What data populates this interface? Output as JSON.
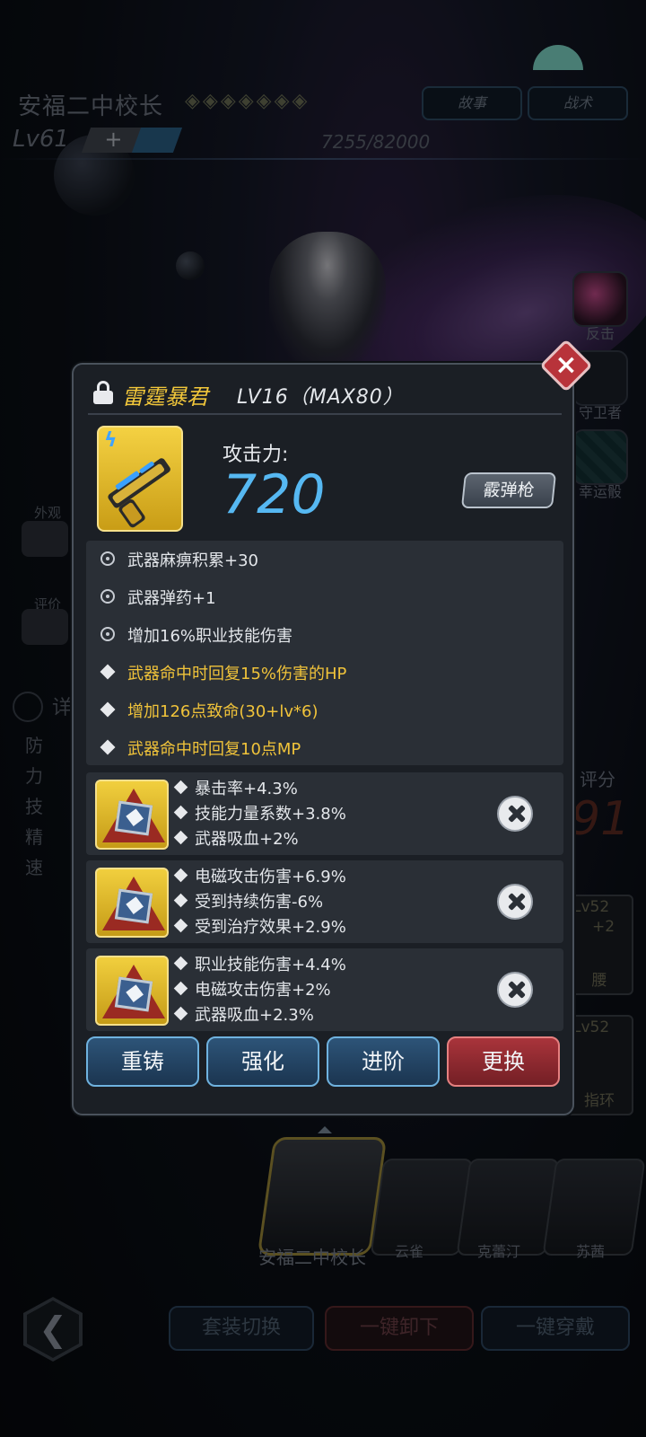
{
  "header": {
    "title": "安福二中校长",
    "stars": "◈◈◈◈◈◈◈",
    "level": "Lv61",
    "level_plus": "+",
    "exp": "7255/82000",
    "buttons": [
      "故事",
      "战术"
    ]
  },
  "right_skills": [
    {
      "label": "反击",
      "icon": "counter-icon"
    },
    {
      "label": "守卫者",
      "icon": "guardian-icon"
    },
    {
      "label": "幸运骰",
      "icon": "lucky-dice-icon"
    }
  ],
  "score": {
    "label": "评分",
    "value": "91"
  },
  "side_slots": [
    {
      "level": "Lv52",
      "extra": "+2",
      "label": "腰"
    },
    {
      "level": "Lv52",
      "label": "指环"
    }
  ],
  "left_panel": {
    "appearance": "外观",
    "review": "评价",
    "detail": "详",
    "stats": [
      "防",
      "力",
      "技",
      "精",
      "速"
    ]
  },
  "modal": {
    "weapon_name": "雷霆暴君",
    "weapon_level": "LV16（MAX80）",
    "attack_label": "攻击力:",
    "attack_value": "720",
    "weapon_type": "霰弹枪",
    "attributes": [
      {
        "text": "武器麻痹积累+30",
        "icon": "gear-icon",
        "highlight": false
      },
      {
        "text": "武器弹药+1",
        "icon": "gear-icon",
        "highlight": false
      },
      {
        "text": "增加16%职业技能伤害",
        "icon": "gear-icon",
        "highlight": false
      },
      {
        "text": "武器命中时回复15%伤害的HP",
        "icon": "diamond-icon",
        "highlight": true
      },
      {
        "text": "增加126点致命(30+lv*6)",
        "icon": "diamond-icon",
        "highlight": true
      },
      {
        "text": "武器命中时回复10点MP",
        "icon": "diamond-icon",
        "highlight": true
      }
    ],
    "gems": [
      {
        "lines": [
          "暴击率+4.3%",
          "技能力量系数+3.8%",
          "武器吸血+2%"
        ]
      },
      {
        "lines": [
          "电磁攻击伤害+6.9%",
          "受到持续伤害-6%",
          "受到治疗效果+2.9%"
        ]
      },
      {
        "lines": [
          "职业技能伤害+4.4%",
          "电磁攻击伤害+2%",
          "武器吸血+2.3%"
        ]
      }
    ],
    "actions": [
      "重铸",
      "强化",
      "进阶",
      "更换"
    ]
  },
  "roster": {
    "main": "安福二中校长",
    "others": [
      "云雀",
      "克蕾汀",
      "苏茜"
    ]
  },
  "bottom": {
    "back": "❮",
    "buttons": [
      "套装切换",
      "一键卸下",
      "一键穿戴"
    ]
  },
  "colors": {
    "gold_text": "#f0c33a",
    "attack_blue": "#56b8f2",
    "replace_red": "#a9343b",
    "action_blue": "#2d5478"
  }
}
